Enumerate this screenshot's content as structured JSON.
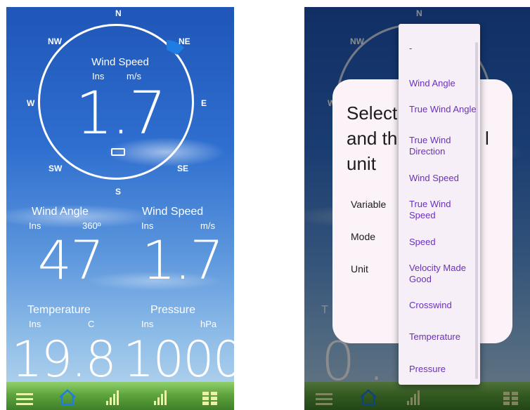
{
  "left_screen": {
    "compass": {
      "cardinals": [
        "N",
        "NE",
        "E",
        "SE",
        "S",
        "SW",
        "W",
        "NW"
      ],
      "title": "Wind Speed",
      "mode": "Ins",
      "unit": "m/s",
      "value": "1.7"
    },
    "tiles": [
      {
        "title": "Wind Angle",
        "mode": "Ins",
        "unit": "360º",
        "value": "47"
      },
      {
        "title": "Wind Speed",
        "mode": "Ins",
        "unit": "m/s",
        "value": "1.7"
      },
      {
        "title": "Temperature",
        "mode": "Ins",
        "unit": "C",
        "value": "19.8"
      },
      {
        "title": "Pressure",
        "mode": "Ins",
        "unit": "hPa",
        "value": "1000"
      }
    ]
  },
  "right_screen": {
    "compass_cardinals": {
      "n": "N",
      "nw": "NW",
      "w": "W"
    },
    "dialog": {
      "title_line1": "Select",
      "title_line2": "and th",
      "title_line3": "unit",
      "title_tail": "l",
      "labels": [
        "Variable",
        "Mode",
        "Unit"
      ]
    },
    "dropdown_items": [
      "-",
      "Wind Angle",
      "True Wind Angle",
      "True Wind Direction",
      "Wind Speed",
      "True Wind Speed",
      "Speed",
      "Velocity Made Good",
      "Crosswind",
      "Temperature",
      "Pressure"
    ],
    "background_value": "0.0",
    "background_label": "T"
  },
  "colors": {
    "accent_blue": "#1e7de3",
    "dropdown_text": "#6b2fbf",
    "icon_green": "#e8f3a8"
  },
  "icons": [
    "menu-icon",
    "home-icon",
    "signal-bars-icon",
    "grid-icon",
    "battery-icon"
  ]
}
